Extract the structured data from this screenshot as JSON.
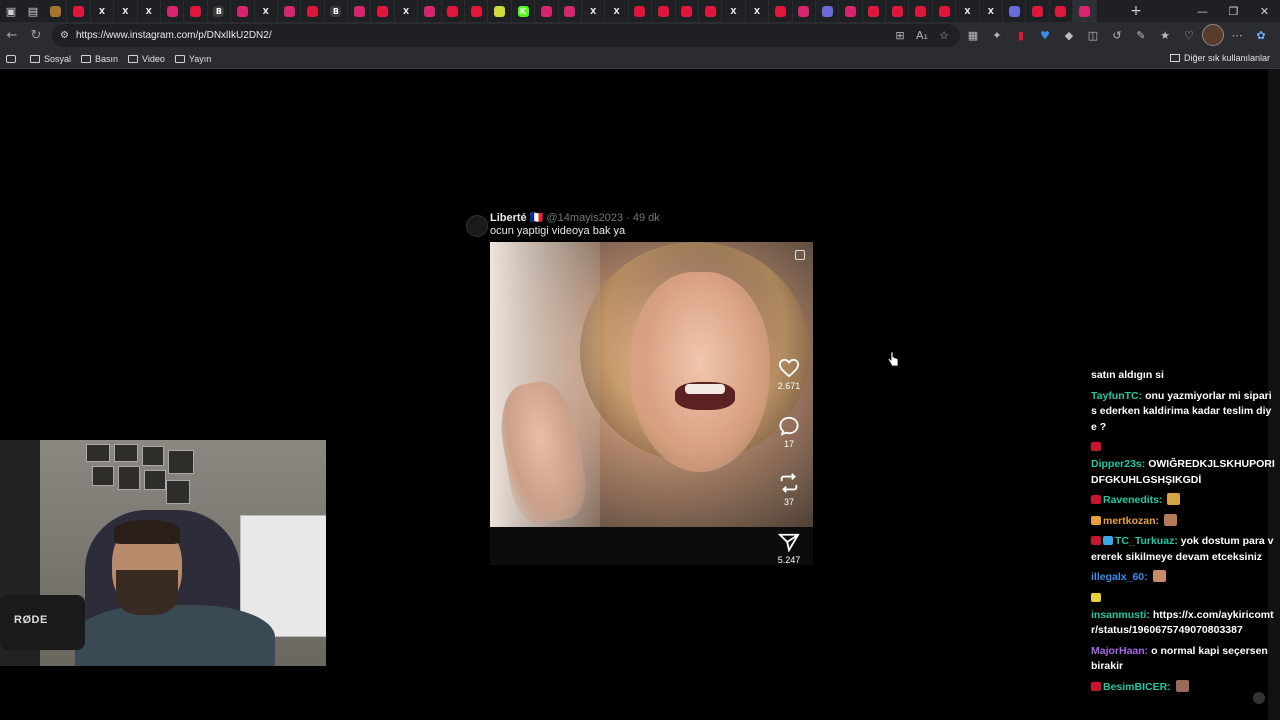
{
  "browser": {
    "url": "https://www.instagram.com/p/DNxlIkU2DN2/",
    "tabs": [
      {
        "icon": "b",
        "color": "#a8742b",
        "letter": ""
      },
      {
        "icon": "youtube",
        "color": "#e1163c",
        "letter": ""
      },
      {
        "icon": "x",
        "color": "#000000",
        "letter": "X"
      },
      {
        "icon": "x",
        "color": "#000000",
        "letter": "X"
      },
      {
        "icon": "x",
        "color": "#000000",
        "letter": "X"
      },
      {
        "icon": "instagram",
        "color": "#d6246e",
        "letter": ""
      },
      {
        "icon": "youtube",
        "color": "#e1163c",
        "letter": ""
      },
      {
        "icon": "b",
        "color": "#3a3a3a",
        "letter": "B"
      },
      {
        "icon": "instagram",
        "color": "#d6246e",
        "letter": ""
      },
      {
        "icon": "x",
        "color": "#000000",
        "letter": "X"
      },
      {
        "icon": "instagram",
        "color": "#d6246e",
        "letter": ""
      },
      {
        "icon": "youtube",
        "color": "#e1163c",
        "letter": ""
      },
      {
        "icon": "b",
        "color": "#3a3a3a",
        "letter": "B"
      },
      {
        "icon": "instagram",
        "color": "#d6246e",
        "letter": ""
      },
      {
        "icon": "youtube",
        "color": "#e1163c",
        "letter": ""
      },
      {
        "icon": "x",
        "color": "#000000",
        "letter": "X"
      },
      {
        "icon": "instagram",
        "color": "#d6246e",
        "letter": ""
      },
      {
        "icon": "youtube",
        "color": "#e1163c",
        "letter": ""
      },
      {
        "icon": "youtube",
        "color": "#e1163c",
        "letter": ""
      },
      {
        "icon": "rumble",
        "color": "#cddc39",
        "letter": ""
      },
      {
        "icon": "kick",
        "color": "#53fc18",
        "letter": "K"
      },
      {
        "icon": "instagram",
        "color": "#d6246e",
        "letter": ""
      },
      {
        "icon": "instagram",
        "color": "#d6246e",
        "letter": ""
      },
      {
        "icon": "x",
        "color": "#000000",
        "letter": "X"
      },
      {
        "icon": "x",
        "color": "#000000",
        "letter": "X"
      },
      {
        "icon": "youtube",
        "color": "#e1163c",
        "letter": ""
      },
      {
        "icon": "youtube",
        "color": "#e1163c",
        "letter": ""
      },
      {
        "icon": "youtube",
        "color": "#e1163c",
        "letter": ""
      },
      {
        "icon": "youtube",
        "color": "#e1163c",
        "letter": ""
      },
      {
        "icon": "x",
        "color": "#000000",
        "letter": "X"
      },
      {
        "icon": "x",
        "color": "#000000",
        "letter": "X"
      },
      {
        "icon": "youtube",
        "color": "#e1163c",
        "letter": ""
      },
      {
        "icon": "instagram",
        "color": "#d6246e",
        "letter": ""
      },
      {
        "icon": "feather",
        "color": "#6a6ad8",
        "letter": ""
      },
      {
        "icon": "instagram",
        "color": "#d6246e",
        "letter": ""
      },
      {
        "icon": "youtube",
        "color": "#e1163c",
        "letter": ""
      },
      {
        "icon": "youtube",
        "color": "#e1163c",
        "letter": ""
      },
      {
        "icon": "youtube",
        "color": "#e1163c",
        "letter": ""
      },
      {
        "icon": "youtube",
        "color": "#e1163c",
        "letter": ""
      },
      {
        "icon": "x",
        "color": "#000000",
        "letter": "X"
      },
      {
        "icon": "x",
        "color": "#000000",
        "letter": "X"
      },
      {
        "icon": "feather",
        "color": "#6a6ad8",
        "letter": ""
      },
      {
        "icon": "youtube",
        "color": "#e1163c",
        "letter": ""
      },
      {
        "icon": "youtube",
        "color": "#e1163c",
        "letter": ""
      },
      {
        "icon": "bing",
        "color": "#d6246e",
        "letter": ""
      }
    ],
    "bookmarks": [
      "Sosyal",
      "Basın",
      "Video",
      "Yayın"
    ],
    "other_bookmarks": "Diğer sık kullanılanlar"
  },
  "tweet": {
    "name": "Liberté 🇫🇷",
    "handle": "@14mayis2023 · 49 dk",
    "text": "ocun yaptigi videoya bak ya",
    "likes": "2.671",
    "comments": "17",
    "reposts": "37",
    "shares": "5.247"
  },
  "webcam": {
    "mic_label": "RØDE"
  },
  "chat": [
    {
      "user": "",
      "user_color": "#ffffff",
      "text": "satın aldıgın si",
      "badges": [],
      "emote": ""
    },
    {
      "user": "TayfunTC:",
      "user_color": "#1ec8a5",
      "text": "onu yazmiyorlar mi siparis ederken kaldirima kadar teslim diye ?",
      "badges": [],
      "emote": ""
    },
    {
      "user": "",
      "user_color": "#ffffff",
      "text": "",
      "badges": [
        "#c7152d"
      ],
      "emote": ""
    },
    {
      "user": "Dipper23s:",
      "user_color": "#1ec8a5",
      "text": "OWIĞREDKJLSKHUPORIDFGKUHLGSHŞIKGDİ",
      "badges": [],
      "emote": ""
    },
    {
      "user": "Ravenedits:",
      "user_color": "#1ec8a5",
      "text": "",
      "badges": [
        "#c7152d"
      ],
      "emote": "#d4a445"
    },
    {
      "user": "mertkozan:",
      "user_color": "#e8a03a",
      "text": "",
      "badges": [
        "#e8a03a"
      ],
      "emote": "#b57a58"
    },
    {
      "user": "TC_Turkuaz:",
      "user_color": "#1ec8a5",
      "text": "yok dostum para vererek sikilmeye devam etceksiniz",
      "badges": [
        "#c7152d",
        "#3aa6e8"
      ],
      "emote": ""
    },
    {
      "user": "illegalx_60:",
      "user_color": "#3a8ee8",
      "text": "",
      "badges": [],
      "emote": "#c98a6a"
    },
    {
      "user": "",
      "user_color": "#ffffff",
      "text": "",
      "badges": [
        "#e8d23a"
      ],
      "emote": ""
    },
    {
      "user": "insanmusti:",
      "user_color": "#1ec8a5",
      "text": "https://x.com/aykiricomtr/status/1960675749070803387",
      "badges": [],
      "emote": ""
    },
    {
      "user": "MajorHaan:",
      "user_color": "#a667e8",
      "text": "o normal kapi seçersen birakir",
      "badges": [],
      "emote": ""
    },
    {
      "user": "BesimBICER:",
      "user_color": "#1ec8a5",
      "text": "",
      "badges": [
        "#c7152d"
      ],
      "emote": "#9a6a5a"
    }
  ]
}
